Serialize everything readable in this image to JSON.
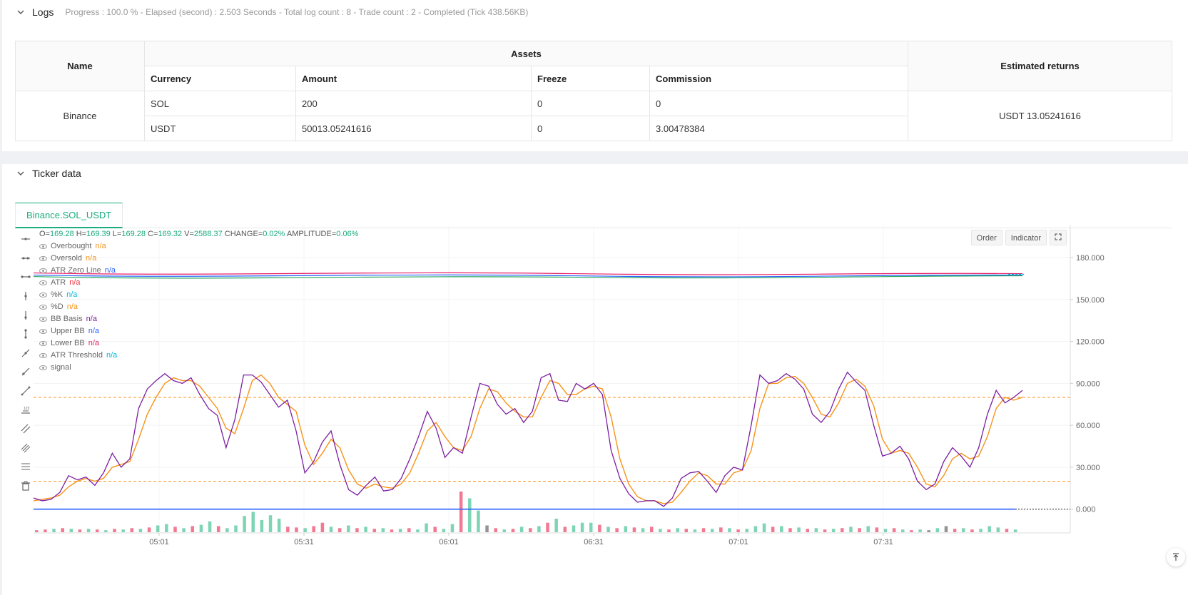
{
  "logs": {
    "title": "Logs",
    "summary": "Progress : 100.0 % - Elapsed (second) : 2.503  Seconds - Total log count : 8 - Trade count : 2 - Completed (Tick 438.56KB)"
  },
  "assets_table": {
    "name_header": "Name",
    "assets_header": "Assets",
    "estimated_header": "Estimated returns",
    "columns": [
      "Currency",
      "Amount",
      "Freeze",
      "Commission"
    ],
    "exchange": "Binance",
    "rows": [
      {
        "currency": "SOL",
        "amount": "200",
        "freeze": "0",
        "commission": "0"
      },
      {
        "currency": "USDT",
        "amount": "50013.05241616",
        "freeze": "0",
        "commission": "3.00478384"
      }
    ],
    "estimated_returns": "USDT 13.05241616"
  },
  "ticker": {
    "title": "Ticker data",
    "tab": "Binance.SOL_USDT",
    "ohlc": {
      "o": "169.28",
      "h": "169.39",
      "l": "169.28",
      "c": "169.32",
      "v": "2588.37",
      "change": "0.02%",
      "amplitude": "0.06%"
    },
    "indicators": [
      {
        "name": "Overbought",
        "value": "n/a",
        "color": "#f7931a"
      },
      {
        "name": "Oversold",
        "value": "n/a",
        "color": "#f7931a"
      },
      {
        "name": "ATR Zero Line",
        "value": "n/a",
        "color": "#2962ff"
      },
      {
        "name": "ATR",
        "value": "n/a",
        "color": "#f23645"
      },
      {
        "name": "%K",
        "value": "n/a",
        "color": "#00bcd4"
      },
      {
        "name": "%D",
        "value": "n/a",
        "color": "#f7931a"
      },
      {
        "name": "BB Basis",
        "value": "n/a",
        "color": "#7b1fa2"
      },
      {
        "name": "Upper BB",
        "value": "n/a",
        "color": "#2962ff"
      },
      {
        "name": "Lower BB",
        "value": "n/a",
        "color": "#e91e63"
      },
      {
        "name": "ATR Threshold",
        "value": "n/a",
        "color": "#00bcd4"
      },
      {
        "name": "signal",
        "value": "",
        "color": "#666666"
      }
    ],
    "buttons": {
      "order": "Order",
      "indicator": "Indicator"
    }
  },
  "chart_data": {
    "type": "line",
    "y_ticks": [
      "180.000",
      "150.000",
      "120.000",
      "90.000",
      "60.000",
      "30.000",
      "0.000"
    ],
    "ylim": [
      -17,
      203
    ],
    "x_ticks": [
      "05:01",
      "05:31",
      "06:01",
      "06:31",
      "07:01",
      "07:31"
    ],
    "overbought": 80,
    "oversold": 20,
    "price_level": 168,
    "k_series": [
      8,
      6,
      7,
      12,
      24,
      21,
      23,
      17,
      26,
      40,
      30,
      36,
      72,
      86,
      92,
      97,
      92,
      90,
      94,
      82,
      72,
      67,
      44,
      64,
      96,
      96,
      91,
      82,
      73,
      78,
      56,
      26,
      34,
      48,
      56,
      32,
      14,
      10,
      17,
      23,
      13,
      14,
      22,
      36,
      52,
      70,
      58,
      37,
      44,
      40,
      66,
      90,
      88,
      75,
      68,
      72,
      62,
      70,
      94,
      97,
      78,
      77,
      90,
      86,
      90,
      82,
      42,
      22,
      11,
      5,
      6,
      6,
      2,
      8,
      22,
      26,
      27,
      20,
      12,
      24,
      30,
      28,
      60,
      96,
      90,
      92,
      97,
      93,
      86,
      68,
      62,
      70,
      86,
      98,
      91,
      85,
      60,
      38,
      40,
      45,
      36,
      20,
      14,
      18,
      34,
      44,
      38,
      30,
      44,
      68,
      85,
      76,
      80,
      85
    ],
    "d_series": [
      6,
      7,
      8,
      10,
      16,
      20,
      22,
      20,
      22,
      30,
      32,
      34,
      50,
      68,
      80,
      90,
      94,
      92,
      92,
      88,
      80,
      72,
      58,
      54,
      72,
      92,
      96,
      90,
      80,
      75,
      70,
      46,
      32,
      40,
      50,
      44,
      28,
      18,
      15,
      18,
      16,
      15,
      18,
      26,
      40,
      56,
      62,
      52,
      44,
      42,
      52,
      72,
      86,
      84,
      76,
      70,
      66,
      66,
      80,
      92,
      90,
      82,
      82,
      86,
      88,
      86,
      66,
      36,
      18,
      9,
      6,
      6,
      4,
      5,
      12,
      20,
      26,
      24,
      18,
      18,
      26,
      28,
      42,
      72,
      90,
      90,
      94,
      95,
      90,
      80,
      68,
      66,
      76,
      90,
      93,
      88,
      74,
      50,
      40,
      42,
      40,
      30,
      18,
      16,
      24,
      36,
      40,
      36,
      38,
      52,
      72,
      80,
      78,
      80
    ],
    "volume": [
      [
        3,
        "d"
      ],
      [
        4,
        "d"
      ],
      [
        5,
        "u"
      ],
      [
        6,
        "d"
      ],
      [
        5,
        "u"
      ],
      [
        4,
        "d"
      ],
      [
        5,
        "u"
      ],
      [
        4,
        "d"
      ],
      [
        3,
        "u"
      ],
      [
        5,
        "d"
      ],
      [
        4,
        "u"
      ],
      [
        6,
        "d"
      ],
      [
        5,
        "u"
      ],
      [
        7,
        "d"
      ],
      [
        10,
        "u"
      ],
      [
        12,
        "u"
      ],
      [
        8,
        "d"
      ],
      [
        6,
        "u"
      ],
      [
        9,
        "d"
      ],
      [
        11,
        "u"
      ],
      [
        16,
        "u"
      ],
      [
        9,
        "d"
      ],
      [
        6,
        "u"
      ],
      [
        10,
        "u"
      ],
      [
        24,
        "u"
      ],
      [
        30,
        "u"
      ],
      [
        18,
        "u"
      ],
      [
        25,
        "u"
      ],
      [
        20,
        "u"
      ],
      [
        8,
        "d"
      ],
      [
        7,
        "d"
      ],
      [
        6,
        "u"
      ],
      [
        9,
        "d"
      ],
      [
        14,
        "d"
      ],
      [
        8,
        "u"
      ],
      [
        6,
        "d"
      ],
      [
        10,
        "u"
      ],
      [
        6,
        "d"
      ],
      [
        8,
        "u"
      ],
      [
        5,
        "d"
      ],
      [
        6,
        "u"
      ],
      [
        4,
        "d"
      ],
      [
        5,
        "u"
      ],
      [
        6,
        "d"
      ],
      [
        4,
        "u"
      ],
      [
        13,
        "u"
      ],
      [
        8,
        "d"
      ],
      [
        5,
        "u"
      ],
      [
        12,
        "u"
      ],
      [
        60,
        "d"
      ],
      [
        50,
        "u"
      ],
      [
        32,
        "u"
      ],
      [
        10,
        "g"
      ],
      [
        6,
        "d"
      ],
      [
        4,
        "u"
      ],
      [
        5,
        "d"
      ],
      [
        8,
        "u"
      ],
      [
        6,
        "d"
      ],
      [
        9,
        "u"
      ],
      [
        14,
        "d"
      ],
      [
        20,
        "u"
      ],
      [
        8,
        "d"
      ],
      [
        10,
        "u"
      ],
      [
        14,
        "u"
      ],
      [
        14,
        "u"
      ],
      [
        11,
        "d"
      ],
      [
        8,
        "u"
      ],
      [
        6,
        "d"
      ],
      [
        9,
        "u"
      ],
      [
        7,
        "d"
      ],
      [
        6,
        "u"
      ],
      [
        8,
        "d"
      ],
      [
        5,
        "u"
      ],
      [
        4,
        "d"
      ],
      [
        6,
        "u"
      ],
      [
        5,
        "d"
      ],
      [
        4,
        "u"
      ],
      [
        6,
        "d"
      ],
      [
        5,
        "u"
      ],
      [
        7,
        "d"
      ],
      [
        6,
        "u"
      ],
      [
        4,
        "d"
      ],
      [
        5,
        "u"
      ],
      [
        9,
        "u"
      ],
      [
        13,
        "u"
      ],
      [
        8,
        "d"
      ],
      [
        9,
        "u"
      ],
      [
        6,
        "d"
      ],
      [
        7,
        "u"
      ],
      [
        5,
        "d"
      ],
      [
        6,
        "u"
      ],
      [
        4,
        "d"
      ],
      [
        5,
        "u"
      ],
      [
        6,
        "d"
      ],
      [
        8,
        "u"
      ],
      [
        6,
        "d"
      ],
      [
        9,
        "u"
      ],
      [
        7,
        "d"
      ],
      [
        5,
        "u"
      ],
      [
        6,
        "d"
      ],
      [
        4,
        "u"
      ],
      [
        3,
        "d"
      ],
      [
        4,
        "u"
      ],
      [
        3,
        "g"
      ],
      [
        6,
        "u"
      ],
      [
        9,
        "g"
      ],
      [
        5,
        "d"
      ],
      [
        6,
        "u"
      ],
      [
        4,
        "d"
      ],
      [
        5,
        "u"
      ],
      [
        9,
        "u"
      ],
      [
        7,
        "u"
      ],
      [
        5,
        "d"
      ],
      [
        4,
        "u"
      ]
    ]
  }
}
